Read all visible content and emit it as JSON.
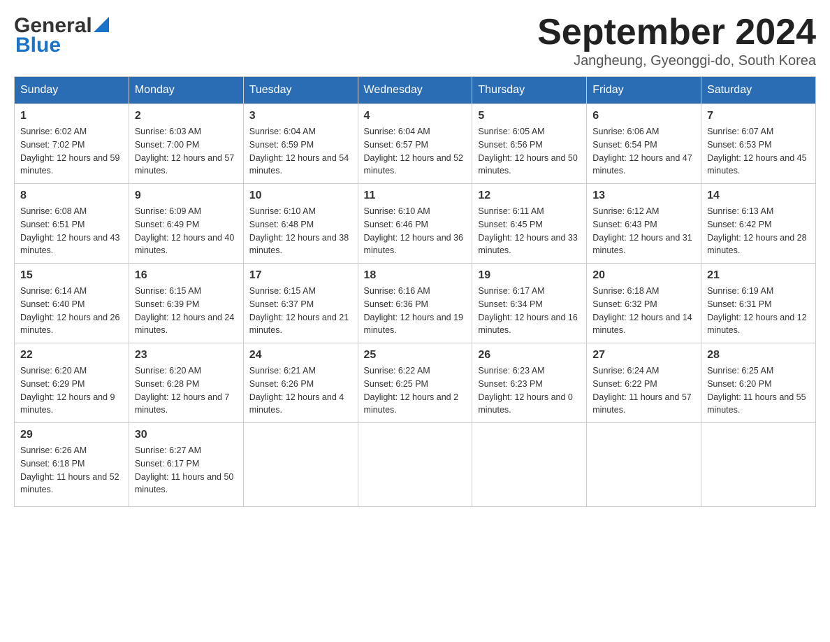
{
  "header": {
    "logo_general": "General",
    "logo_blue": "Blue",
    "month_title": "September 2024",
    "location": "Jangheung, Gyeonggi-do, South Korea"
  },
  "days_of_week": [
    "Sunday",
    "Monday",
    "Tuesday",
    "Wednesday",
    "Thursday",
    "Friday",
    "Saturday"
  ],
  "weeks": [
    [
      {
        "day": "1",
        "sunrise": "Sunrise: 6:02 AM",
        "sunset": "Sunset: 7:02 PM",
        "daylight": "Daylight: 12 hours and 59 minutes."
      },
      {
        "day": "2",
        "sunrise": "Sunrise: 6:03 AM",
        "sunset": "Sunset: 7:00 PM",
        "daylight": "Daylight: 12 hours and 57 minutes."
      },
      {
        "day": "3",
        "sunrise": "Sunrise: 6:04 AM",
        "sunset": "Sunset: 6:59 PM",
        "daylight": "Daylight: 12 hours and 54 minutes."
      },
      {
        "day": "4",
        "sunrise": "Sunrise: 6:04 AM",
        "sunset": "Sunset: 6:57 PM",
        "daylight": "Daylight: 12 hours and 52 minutes."
      },
      {
        "day": "5",
        "sunrise": "Sunrise: 6:05 AM",
        "sunset": "Sunset: 6:56 PM",
        "daylight": "Daylight: 12 hours and 50 minutes."
      },
      {
        "day": "6",
        "sunrise": "Sunrise: 6:06 AM",
        "sunset": "Sunset: 6:54 PM",
        "daylight": "Daylight: 12 hours and 47 minutes."
      },
      {
        "day": "7",
        "sunrise": "Sunrise: 6:07 AM",
        "sunset": "Sunset: 6:53 PM",
        "daylight": "Daylight: 12 hours and 45 minutes."
      }
    ],
    [
      {
        "day": "8",
        "sunrise": "Sunrise: 6:08 AM",
        "sunset": "Sunset: 6:51 PM",
        "daylight": "Daylight: 12 hours and 43 minutes."
      },
      {
        "day": "9",
        "sunrise": "Sunrise: 6:09 AM",
        "sunset": "Sunset: 6:49 PM",
        "daylight": "Daylight: 12 hours and 40 minutes."
      },
      {
        "day": "10",
        "sunrise": "Sunrise: 6:10 AM",
        "sunset": "Sunset: 6:48 PM",
        "daylight": "Daylight: 12 hours and 38 minutes."
      },
      {
        "day": "11",
        "sunrise": "Sunrise: 6:10 AM",
        "sunset": "Sunset: 6:46 PM",
        "daylight": "Daylight: 12 hours and 36 minutes."
      },
      {
        "day": "12",
        "sunrise": "Sunrise: 6:11 AM",
        "sunset": "Sunset: 6:45 PM",
        "daylight": "Daylight: 12 hours and 33 minutes."
      },
      {
        "day": "13",
        "sunrise": "Sunrise: 6:12 AM",
        "sunset": "Sunset: 6:43 PM",
        "daylight": "Daylight: 12 hours and 31 minutes."
      },
      {
        "day": "14",
        "sunrise": "Sunrise: 6:13 AM",
        "sunset": "Sunset: 6:42 PM",
        "daylight": "Daylight: 12 hours and 28 minutes."
      }
    ],
    [
      {
        "day": "15",
        "sunrise": "Sunrise: 6:14 AM",
        "sunset": "Sunset: 6:40 PM",
        "daylight": "Daylight: 12 hours and 26 minutes."
      },
      {
        "day": "16",
        "sunrise": "Sunrise: 6:15 AM",
        "sunset": "Sunset: 6:39 PM",
        "daylight": "Daylight: 12 hours and 24 minutes."
      },
      {
        "day": "17",
        "sunrise": "Sunrise: 6:15 AM",
        "sunset": "Sunset: 6:37 PM",
        "daylight": "Daylight: 12 hours and 21 minutes."
      },
      {
        "day": "18",
        "sunrise": "Sunrise: 6:16 AM",
        "sunset": "Sunset: 6:36 PM",
        "daylight": "Daylight: 12 hours and 19 minutes."
      },
      {
        "day": "19",
        "sunrise": "Sunrise: 6:17 AM",
        "sunset": "Sunset: 6:34 PM",
        "daylight": "Daylight: 12 hours and 16 minutes."
      },
      {
        "day": "20",
        "sunrise": "Sunrise: 6:18 AM",
        "sunset": "Sunset: 6:32 PM",
        "daylight": "Daylight: 12 hours and 14 minutes."
      },
      {
        "day": "21",
        "sunrise": "Sunrise: 6:19 AM",
        "sunset": "Sunset: 6:31 PM",
        "daylight": "Daylight: 12 hours and 12 minutes."
      }
    ],
    [
      {
        "day": "22",
        "sunrise": "Sunrise: 6:20 AM",
        "sunset": "Sunset: 6:29 PM",
        "daylight": "Daylight: 12 hours and 9 minutes."
      },
      {
        "day": "23",
        "sunrise": "Sunrise: 6:20 AM",
        "sunset": "Sunset: 6:28 PM",
        "daylight": "Daylight: 12 hours and 7 minutes."
      },
      {
        "day": "24",
        "sunrise": "Sunrise: 6:21 AM",
        "sunset": "Sunset: 6:26 PM",
        "daylight": "Daylight: 12 hours and 4 minutes."
      },
      {
        "day": "25",
        "sunrise": "Sunrise: 6:22 AM",
        "sunset": "Sunset: 6:25 PM",
        "daylight": "Daylight: 12 hours and 2 minutes."
      },
      {
        "day": "26",
        "sunrise": "Sunrise: 6:23 AM",
        "sunset": "Sunset: 6:23 PM",
        "daylight": "Daylight: 12 hours and 0 minutes."
      },
      {
        "day": "27",
        "sunrise": "Sunrise: 6:24 AM",
        "sunset": "Sunset: 6:22 PM",
        "daylight": "Daylight: 11 hours and 57 minutes."
      },
      {
        "day": "28",
        "sunrise": "Sunrise: 6:25 AM",
        "sunset": "Sunset: 6:20 PM",
        "daylight": "Daylight: 11 hours and 55 minutes."
      }
    ],
    [
      {
        "day": "29",
        "sunrise": "Sunrise: 6:26 AM",
        "sunset": "Sunset: 6:18 PM",
        "daylight": "Daylight: 11 hours and 52 minutes."
      },
      {
        "day": "30",
        "sunrise": "Sunrise: 6:27 AM",
        "sunset": "Sunset: 6:17 PM",
        "daylight": "Daylight: 11 hours and 50 minutes."
      },
      null,
      null,
      null,
      null,
      null
    ]
  ]
}
